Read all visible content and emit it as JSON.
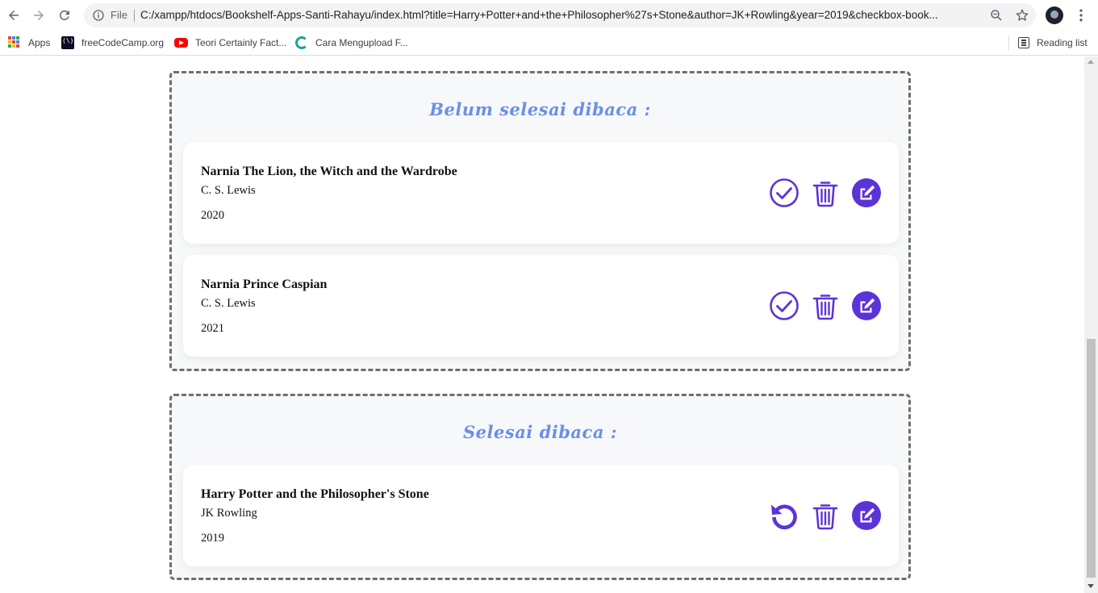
{
  "browser": {
    "file_label": "File",
    "url": "C:/xampp/htdocs/Bookshelf-Apps-Santi-Rahayu/index.html?title=Harry+Potter+and+the+Philosopher%27s+Stone&author=JK+Rowling&year=2019&checkbox-book..."
  },
  "bookmarks": {
    "items": [
      {
        "label": "Apps",
        "icon": "apps-grid-icon"
      },
      {
        "label": "freeCodeCamp.org",
        "icon": "freecodecamp-icon"
      },
      {
        "label": "Teori Certainly Fact...",
        "icon": "youtube-icon"
      },
      {
        "label": "Cara Mengupload F...",
        "icon": "site-icon"
      }
    ],
    "reading_list": "Reading list"
  },
  "shelves": {
    "unfinished": {
      "title": "Belum selesai dibaca :",
      "books": [
        {
          "title": "Narnia The Lion, the Witch and the Wardrobe",
          "author": "C. S. Lewis",
          "year": "2020"
        },
        {
          "title": "Narnia Prince Caspian",
          "author": "C. S. Lewis",
          "year": "2021"
        }
      ]
    },
    "finished": {
      "title": "Selesai dibaca :",
      "books": [
        {
          "title": "Harry Potter and the Philosopher's Stone",
          "author": "JK Rowling",
          "year": "2019"
        }
      ]
    }
  },
  "colors": {
    "accent": "#5b34d8",
    "shelf_title": "#6a8fe8",
    "shelf_border": "#6e6e6e"
  }
}
